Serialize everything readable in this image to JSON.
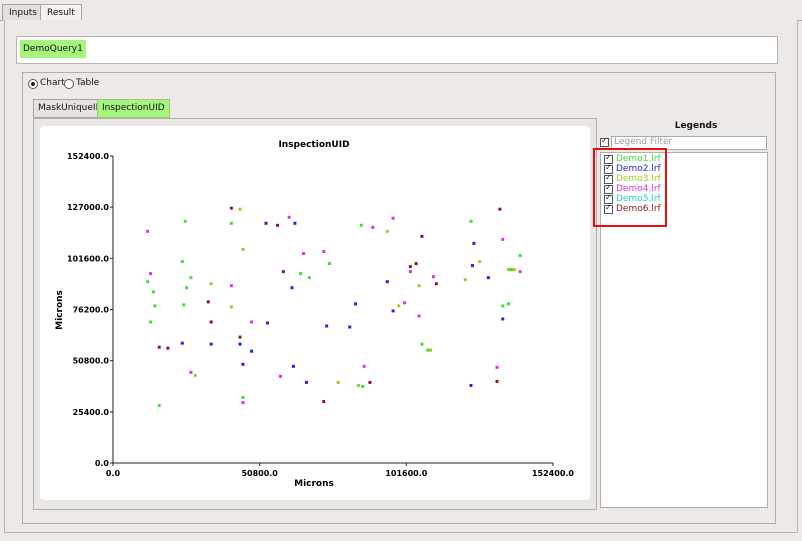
{
  "tabs": [
    {
      "label": "Inputs",
      "active": false
    },
    {
      "label": "Result",
      "active": true
    }
  ],
  "query": {
    "label": "DemoQuery1",
    "color": "#a6f57d"
  },
  "view_mode": {
    "options": [
      "Chart",
      "Table"
    ],
    "selected": "Chart"
  },
  "subtabs": [
    {
      "label": "MaskUniqueID",
      "active": false
    },
    {
      "label": "InspectionUID",
      "active": true
    }
  ],
  "legends": {
    "title": "Legends",
    "filter_placeholder": "Legend Filter",
    "filter_checked": true,
    "items": [
      {
        "label": "Demo1.lrf",
        "color": "#3dde3d",
        "checked": true
      },
      {
        "label": "Demo2.lrf",
        "color": "#2323e0",
        "checked": true
      },
      {
        "label": "Demo3.lrf",
        "color": "#a0c81e",
        "checked": true
      },
      {
        "label": "Demo4.lrf",
        "color": "#e030e0",
        "checked": true
      },
      {
        "label": "Demo5.lrf",
        "color": "#20d0d0",
        "checked": true
      },
      {
        "label": "Demo6.lrf",
        "color": "#8b1a1a",
        "checked": true
      }
    ]
  },
  "chart_data": {
    "type": "scatter",
    "title": "InspectionUID",
    "xlabel": "Microns",
    "ylabel": "Microns",
    "xlim": [
      0,
      152400
    ],
    "ylim": [
      0,
      152400
    ],
    "xticks": [
      "0.0",
      "50800.0",
      "101600.0",
      "152400.0"
    ],
    "yticks": [
      "0.0",
      "25400.0",
      "50800.0",
      "76200.0",
      "101600.0",
      "127000.0",
      "152400.0"
    ],
    "grid": false,
    "series": [
      {
        "name": "Demo1.lrf",
        "color": "#3dde3d",
        "points": [
          [
            12000,
            90000
          ],
          [
            13000,
            70000
          ],
          [
            14000,
            85000
          ],
          [
            14500,
            78000
          ],
          [
            16000,
            28500
          ],
          [
            24000,
            100000
          ],
          [
            24500,
            78500
          ],
          [
            25000,
            120000
          ],
          [
            25500,
            87000
          ],
          [
            27000,
            92000
          ],
          [
            41000,
            119000
          ],
          [
            45000,
            32500
          ],
          [
            65000,
            94000
          ],
          [
            68000,
            92000
          ],
          [
            75000,
            99000
          ],
          [
            86000,
            118000
          ],
          [
            86500,
            38000
          ],
          [
            107000,
            59000
          ],
          [
            109000,
            56000
          ],
          [
            124000,
            120000
          ],
          [
            135000,
            78000
          ],
          [
            137000,
            79000
          ],
          [
            138000,
            96000
          ],
          [
            141000,
            103000
          ]
        ]
      },
      {
        "name": "Demo2.lrf",
        "color": "#2323e0",
        "points": [
          [
            24000,
            59500
          ],
          [
            34000,
            59000
          ],
          [
            44000,
            59000
          ],
          [
            45000,
            49000
          ],
          [
            48000,
            55500
          ],
          [
            53000,
            119000
          ],
          [
            53500,
            69500
          ],
          [
            62000,
            87000
          ],
          [
            62500,
            48000
          ],
          [
            63000,
            119000
          ],
          [
            67000,
            40000
          ],
          [
            74000,
            68000
          ],
          [
            82000,
            67500
          ],
          [
            84000,
            79000
          ],
          [
            95000,
            90000
          ],
          [
            97000,
            75500
          ],
          [
            124000,
            38500
          ],
          [
            124500,
            98000
          ],
          [
            125000,
            109000
          ],
          [
            130000,
            92000
          ],
          [
            135000,
            71500
          ]
        ]
      },
      {
        "name": "Demo3.lrf",
        "color": "#a0c81e",
        "points": [
          [
            28500,
            43500
          ],
          [
            34000,
            89000
          ],
          [
            41000,
            77500
          ],
          [
            44000,
            126000
          ],
          [
            45000,
            106000
          ],
          [
            78000,
            40000
          ],
          [
            85000,
            38500
          ],
          [
            95000,
            115000
          ],
          [
            99000,
            78000
          ],
          [
            106000,
            88000
          ],
          [
            110000,
            56000
          ],
          [
            122000,
            91000
          ],
          [
            127000,
            100000
          ],
          [
            137000,
            96000
          ],
          [
            139000,
            96000
          ]
        ]
      },
      {
        "name": "Demo4.lrf",
        "color": "#e030e0",
        "points": [
          [
            12000,
            115000
          ],
          [
            13000,
            94000
          ],
          [
            27000,
            45000
          ],
          [
            41000,
            88000
          ],
          [
            45000,
            30000
          ],
          [
            48000,
            70000
          ],
          [
            58000,
            43000
          ],
          [
            61000,
            122000
          ],
          [
            66000,
            104000
          ],
          [
            73000,
            105000
          ],
          [
            87000,
            48000
          ],
          [
            90000,
            117000
          ],
          [
            97000,
            121500
          ],
          [
            101000,
            79500
          ],
          [
            103000,
            95000
          ],
          [
            106000,
            73000
          ],
          [
            111000,
            92500
          ],
          [
            133000,
            47500
          ],
          [
            135000,
            111000
          ],
          [
            141000,
            95000
          ]
        ]
      },
      {
        "name": "Demo5.lrf",
        "color": "#20d0d0",
        "points": []
      },
      {
        "name": "Demo6.lrf",
        "color": "#8b1a1a",
        "points": [
          [
            16000,
            57500
          ],
          [
            19000,
            57000
          ],
          [
            33000,
            80000
          ],
          [
            34000,
            70000
          ],
          [
            41000,
            126500
          ],
          [
            44000,
            62500
          ],
          [
            57000,
            118000
          ],
          [
            59000,
            95000
          ],
          [
            73000,
            30500
          ],
          [
            89000,
            40000
          ],
          [
            103000,
            97500
          ],
          [
            105000,
            99000
          ],
          [
            107000,
            112500
          ],
          [
            112000,
            89000
          ],
          [
            133000,
            40500
          ],
          [
            134000,
            126000
          ]
        ]
      }
    ]
  }
}
